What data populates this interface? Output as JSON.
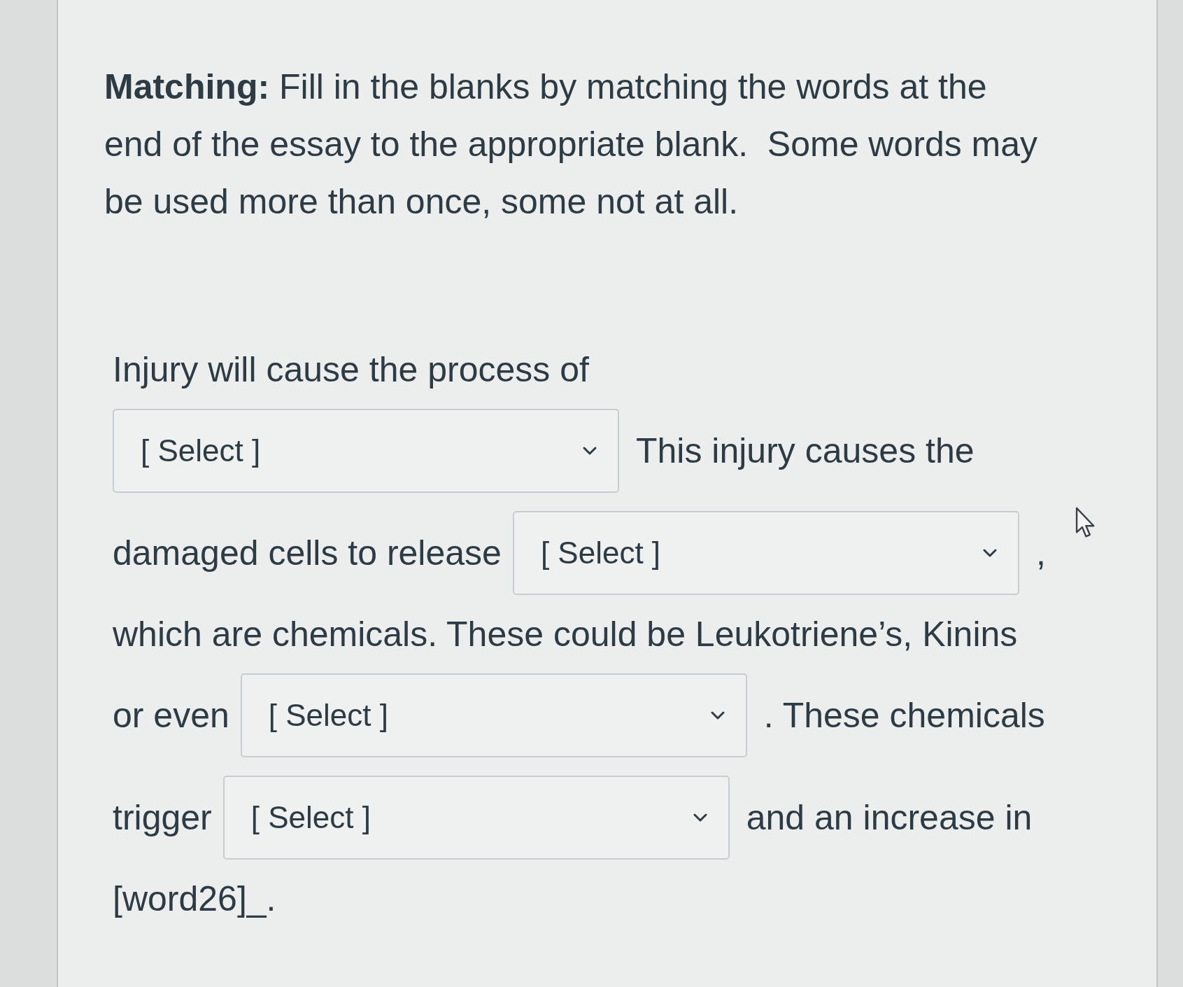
{
  "instructions": "**Matching:** Fill in the blanks by matching the words at the\nend of the essay to the appropriate blank.  Some words may\nbe used more than once, some not at all.",
  "passage": [
    {
      "parts": [
        {
          "kind": "text",
          "text": "Injury will cause the process of"
        }
      ]
    },
    {
      "parts": [
        {
          "kind": "select",
          "placeholder": "[ Select ]"
        },
        {
          "kind": "text",
          "text": "This injury causes the"
        }
      ]
    },
    {
      "parts": [
        {
          "kind": "text",
          "text": "damaged cells to release"
        },
        {
          "kind": "select",
          "placeholder": "[ Select ]"
        },
        {
          "kind": "text",
          "text": ","
        }
      ]
    },
    {
      "parts": [
        {
          "kind": "text",
          "text": "which are chemicals. These could be Leukotriene’s, Kinins"
        }
      ]
    },
    {
      "parts": [
        {
          "kind": "text",
          "text": "or even"
        },
        {
          "kind": "select",
          "placeholder": "[ Select ]"
        },
        {
          "kind": "text",
          "text": ". These chemicals"
        }
      ]
    },
    {
      "parts": [
        {
          "kind": "text",
          "text": "trigger"
        },
        {
          "kind": "select",
          "placeholder": "[ Select ]"
        },
        {
          "kind": "text",
          "text": "and an increase in"
        }
      ]
    },
    {
      "parts": [
        {
          "kind": "text",
          "text": "[word26]_."
        }
      ]
    }
  ]
}
